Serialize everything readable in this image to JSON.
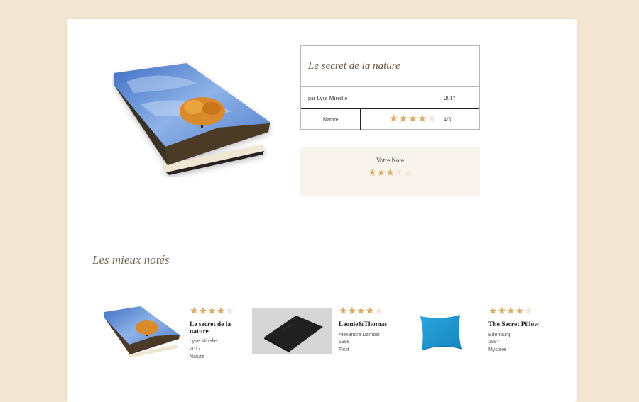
{
  "book": {
    "title": "Le secret de la nature",
    "author": "par Lyse Mireille",
    "year": "2017",
    "genre": "Nature",
    "rating": 4,
    "rating_text": "4/5"
  },
  "vote": {
    "label": "Votre Note",
    "rating": 3
  },
  "section": {
    "title": "Les mieux notés"
  },
  "top_items": [
    {
      "title": "Le secret de la nature",
      "author": "Lyse Mireille",
      "year": "2017",
      "genre": "Nature",
      "rating": 4
    },
    {
      "title": "Leonie&Thomas",
      "author": "Alexandre Dambal",
      "year": "1998",
      "genre": "Fictif",
      "rating": 4
    },
    {
      "title": "The Secret Pillow",
      "author": "Edenburg",
      "year": "1997",
      "genre": "Mystère",
      "rating": 4
    }
  ],
  "colors": {
    "star_on": "#d9ab64",
    "star_off": "#f1e6d4",
    "page_bg": "#f3e6d3"
  },
  "icons": {
    "star": "star-icon"
  }
}
